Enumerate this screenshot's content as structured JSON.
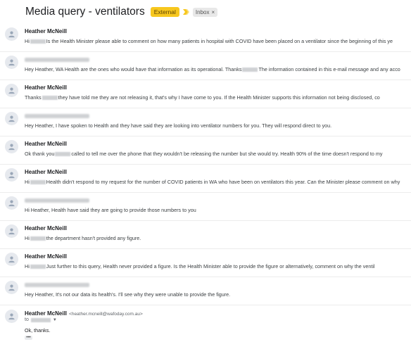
{
  "thread": {
    "subject": "Media query - ventilators",
    "labels": {
      "external": "External",
      "inbox": "Inbox",
      "remove": "×"
    },
    "colors": {
      "external_bg": "#f7c71e",
      "chevron": "#f7c71e"
    }
  },
  "messages": [
    {
      "sender": "Heather McNeill",
      "sender_redacted": false,
      "pre": "Hi",
      "redacted": true,
      "post": "Is the Health Minister please able to comment on how many patients in hospital with COVID have been placed on a ventilator since the beginning of this ye"
    },
    {
      "sender": "",
      "sender_redacted": true,
      "pre": "Hey Heather, WA Health are the ones who would have that information as its operational. Thanks",
      "redacted": true,
      "post": "The information contained in this e-mail message and any acco"
    },
    {
      "sender": "Heather McNeill",
      "sender_redacted": false,
      "pre": "Thanks",
      "redacted": true,
      "post": "they have told me they are not releasing it, that's why I have come to you. If the Health Minister supports this information not being disclosed, co"
    },
    {
      "sender": "",
      "sender_redacted": true,
      "pre": "Hey Heather, I have spoken to Health and they have said they are looking into ventilator numbers for you. They will respond direct to you.",
      "redacted": false,
      "post": ""
    },
    {
      "sender": "Heather McNeill",
      "sender_redacted": false,
      "pre": "Ok thank you",
      "redacted": true,
      "post": "called to tell me over the phone that they wouldn't be releasing the number but she would try. Health 90% of the time doesn't respond to my"
    },
    {
      "sender": "Heather McNeill",
      "sender_redacted": false,
      "pre": "Hi",
      "redacted": true,
      "post": "Health didn't respond to my request for the number of COVID patients in WA who have been on ventilators this year. Can the Minister please comment on why"
    },
    {
      "sender": "",
      "sender_redacted": true,
      "pre": "Hi Heather, Health have said they are going to provide those numbers to you",
      "redacted": false,
      "post": ""
    },
    {
      "sender": "Heather McNeill",
      "sender_redacted": false,
      "pre": "Hi",
      "redacted": true,
      "post": "the department hasn't provided any figure."
    },
    {
      "sender": "Heather McNeill",
      "sender_redacted": false,
      "pre": "Hi",
      "redacted": true,
      "post": "Just further to this query, Health never provided a figure. Is the Health Minister able to provide the figure or alternatively, comment on why the ventil"
    },
    {
      "sender": "",
      "sender_redacted": true,
      "pre": "Hey Heather, It's not our data its health's. I'll see why they were unable to provide the figure.",
      "redacted": false,
      "post": ""
    }
  ],
  "expanded": {
    "sender": "Heather McNeill",
    "email": "<heather.mcneill@wafoday.com.au>",
    "to_label": "to",
    "body": "Ok, thanks.",
    "more": "•••"
  }
}
